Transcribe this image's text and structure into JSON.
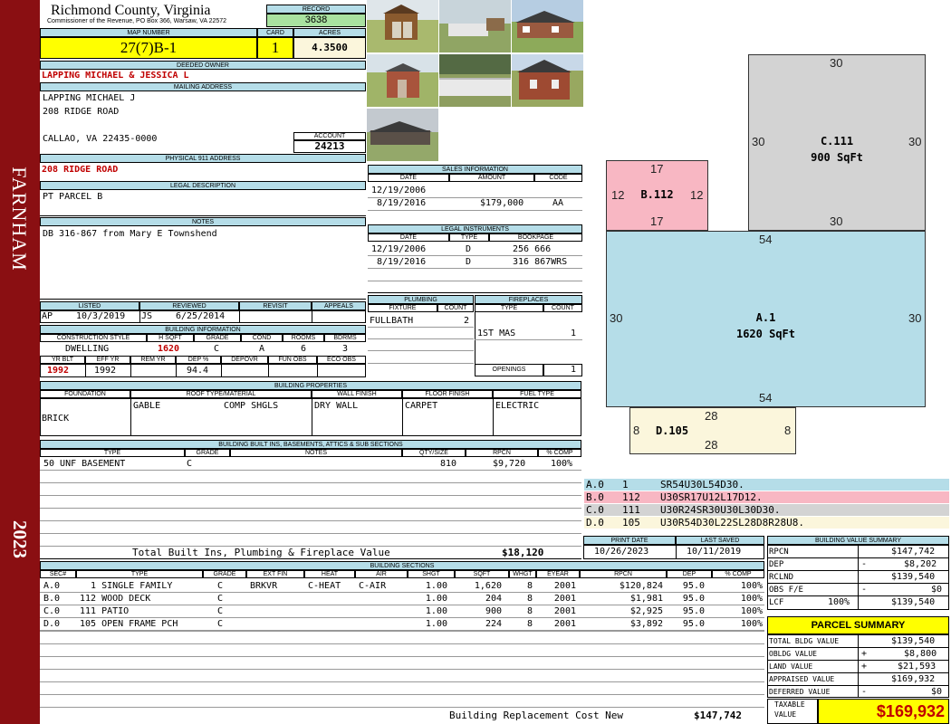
{
  "sidebar": {
    "district": "FARNHAM",
    "year": "2023"
  },
  "header": {
    "county": "Richmond County, Virginia",
    "commissioner": "Commissioner of the Revenue, PO Box 366, Warsaw, VA 22572",
    "record_label": "RECORD",
    "record": "3638",
    "map_label": "MAP NUMBER",
    "map": "27(7)B-1",
    "card_label": "CARD",
    "card": "1",
    "acres_label": "ACRES",
    "acres": "4.3500"
  },
  "owner": {
    "label": "DEEDED OWNER",
    "name": "LAPPING MICHAEL & JESSICA L",
    "mail_label": "MAILING ADDRESS",
    "mail1": "LAPPING MICHAEL J",
    "mail2": "208 RIDGE ROAD",
    "mail3": "CALLAO, VA 22435-0000",
    "account_label": "ACCOUNT",
    "account": "24213",
    "phys_label": "PHYSICAL 911 ADDRESS",
    "phys": "208 RIDGE ROAD",
    "legal_label": "LEGAL DESCRIPTION",
    "legal": "PT PARCEL B",
    "notes_label": "NOTES",
    "notes": "DB 316-867 from Mary E Townshend"
  },
  "sales": {
    "label": "SALES INFORMATION",
    "h_date": "DATE",
    "h_amount": "AMOUNT",
    "h_code": "CODE",
    "rows": [
      {
        "date": "12/19/2006",
        "amount": "",
        "code": ""
      },
      {
        "date": "8/19/2016",
        "amount": "$179,000",
        "code": "AA"
      }
    ]
  },
  "instruments": {
    "label": "LEGAL INSTRUMENTS",
    "h_date": "DATE",
    "h_type": "TYPE",
    "h_book": "BOOKPAGE",
    "rows": [
      {
        "date": "12/19/2006",
        "type": "D",
        "book": "256 666"
      },
      {
        "date": "8/19/2016",
        "type": "D",
        "book": "316 867WRS"
      }
    ]
  },
  "plumbing": {
    "label": "PLUMBING",
    "h_fixture": "FIXTURE",
    "h_count": "COUNT",
    "fixture": "FULLBATH",
    "count": "2"
  },
  "fireplaces": {
    "label": "FIREPLACES",
    "h_type": "TYPE",
    "h_count": "COUNT",
    "type": "1ST MAS",
    "count": "1",
    "openings_label": "OPENINGS",
    "openings": "1"
  },
  "review": {
    "listed_label": "LISTED",
    "reviewed_label": "REVIEWED",
    "revisit_label": "REVISIT",
    "appeals_label": "APPEALS",
    "listed_by": "AP",
    "listed": "10/3/2019",
    "reviewed_by": "JS",
    "reviewed": "6/25/2014"
  },
  "building": {
    "label": "BUILDING INFORMATION",
    "h_style": "CONSTRUCTION STYLE",
    "h_hsqft": "H SQFT",
    "h_grade": "GRADE",
    "h_cond": "COND",
    "h_rooms": "ROOMS",
    "h_bdrms": "BDRMS",
    "style": "DWELLING",
    "hsqft": "1620",
    "grade": "C",
    "cond": "A",
    "rooms": "6",
    "bdrms": "3",
    "h_yrblt": "YR BLT",
    "h_effyr": "EFF YR",
    "h_remyr": "REM YR",
    "h_dep": "DEP %",
    "h_depovr": "DEPOVR",
    "h_funobs": "FUN OBS",
    "h_ecoobs": "ECO OBS",
    "yrblt": "1992",
    "effyr": "1992",
    "dep": "94.4"
  },
  "props": {
    "label": "BUILDING PROPERTIES",
    "h_found": "FOUNDATION",
    "h_roof": "ROOF TYPE/MATERIAL",
    "h_wall": "WALL FINISH",
    "h_floor": "FLOOR FINISH",
    "h_fuel": "FUEL TYPE",
    "found": "BRICK",
    "roof1": "GABLE",
    "roof2": "COMP SHGLS",
    "wall": "DRY WALL",
    "floor": "CARPET",
    "fuel": "ELECTRIC"
  },
  "builtins": {
    "label": "BUILDING BUILT INS, BASEMENTS, ATTICS & SUB SECTIONS",
    "h_type": "TYPE",
    "h_grade": "GRADE",
    "h_notes": "NOTES",
    "h_qty": "QTY/SIZE",
    "h_rpcn": "RPCN",
    "h_comp": "% COMP",
    "row": {
      "type": "50 UNF BASEMENT",
      "grade": "C",
      "qty": "810",
      "rpcn": "$9,720",
      "comp": "100%"
    },
    "total_label": "Total Built Ins, Plumbing & Fireplace Value",
    "total": "$18,120"
  },
  "dates": {
    "print_label": "PRINT DATE",
    "print": "10/26/2023",
    "saved_label": "LAST SAVED",
    "saved": "10/11/2019"
  },
  "sections": {
    "label": "BUILDING SECTIONS",
    "headers": [
      "SEC#",
      "TYPE",
      "GRADE",
      "EXT FIN",
      "HEAT",
      "AIR",
      "SHGT",
      "SQFT",
      "WHGT",
      "EYEAR",
      "RPCN",
      "DEP",
      "% COMP"
    ],
    "rows": [
      {
        "sec": "A.0",
        "type": "  1 SINGLE FAMILY",
        "grade": "C",
        "ext": "BRKVR",
        "heat": "C-HEAT",
        "air": "C-AIR",
        "shgt": "1.00",
        "sqft": "1,620",
        "whgt": "8",
        "eyear": "2001",
        "rpcn": "$120,824",
        "dep": "95.0",
        "comp": "100%"
      },
      {
        "sec": "B.0",
        "type": "112 WOOD DECK",
        "grade": "C",
        "ext": "",
        "heat": "",
        "air": "",
        "shgt": "1.00",
        "sqft": "204",
        "whgt": "8",
        "eyear": "2001",
        "rpcn": "$1,981",
        "dep": "95.0",
        "comp": "100%"
      },
      {
        "sec": "C.0",
        "type": "111 PATIO",
        "grade": "C",
        "ext": "",
        "heat": "",
        "air": "",
        "shgt": "1.00",
        "sqft": "900",
        "whgt": "8",
        "eyear": "2001",
        "rpcn": "$2,925",
        "dep": "95.0",
        "comp": "100%"
      },
      {
        "sec": "D.0",
        "type": "105 OPEN FRAME PCH",
        "grade": "C",
        "ext": "",
        "heat": "",
        "air": "",
        "shgt": "1.00",
        "sqft": "224",
        "whgt": "8",
        "eyear": "2001",
        "rpcn": "$3,892",
        "dep": "95.0",
        "comp": "100%"
      }
    ],
    "brcn_label": "Building Replacement Cost New",
    "brcn": "$147,742"
  },
  "sketch": {
    "a": {
      "name": "A.1",
      "area": "1620 SqFt",
      "top": "54",
      "bottom": "54",
      "left": "30",
      "right": "30"
    },
    "b": {
      "name": "B.112",
      "top": "17",
      "bottom": "17",
      "left": "12",
      "right": "12"
    },
    "c": {
      "name": "C.111",
      "area": "900 SqFt",
      "top": "30",
      "bottom": "30",
      "left": "30",
      "right": "30"
    },
    "d": {
      "name": "D.105",
      "top": "28",
      "bottom": "28",
      "left": "8",
      "right": "8"
    },
    "vectors": [
      {
        "sec": "A.0",
        "code": "1",
        "vec": "SR54U30L54D30.",
        "color": "#b5dde8"
      },
      {
        "sec": "B.0",
        "code": "112",
        "vec": "U30SR17U12L17D12.",
        "color": "#f8b7c3"
      },
      {
        "sec": "C.0",
        "code": "111",
        "vec": "U30R24SR30U30L30D30.",
        "color": "#d3d3d3"
      },
      {
        "sec": "D.0",
        "code": "105",
        "vec": "U30R54D30L22SL28D8R28U8.",
        "color": "#fbf6dc"
      }
    ]
  },
  "bvs": {
    "label": "BUILDING VALUE SUMMARY",
    "rpcn_l": "RPCN",
    "rpcn": "$147,742",
    "dep_l": "DEP",
    "dep_s": "-",
    "dep": "$8,202",
    "rclnd_l": "RCLND",
    "rclnd": "$139,540",
    "obs_l": "OBS F/E",
    "obs_s": "-",
    "obs": "$0",
    "lcf_l": "LCF",
    "lcf_p": "100%",
    "lcf": "$139,540"
  },
  "parcel": {
    "label": "PARCEL SUMMARY",
    "tbv_l": "TOTAL BLDG VALUE",
    "tbv": "$139,540",
    "obldg_l": "OBLDG VALUE",
    "obldg_s": "+",
    "obldg": "$8,800",
    "land_l": "LAND VALUE",
    "land_s": "+",
    "land": "$21,593",
    "appr_l": "APPRAISED VALUE",
    "appr": "$169,932",
    "def_l": "DEFERRED VALUE",
    "def_s": "-",
    "def": "$0",
    "tax_l1": "TAXABLE",
    "tax_l2": "VALUE",
    "tax": "$169,932"
  }
}
